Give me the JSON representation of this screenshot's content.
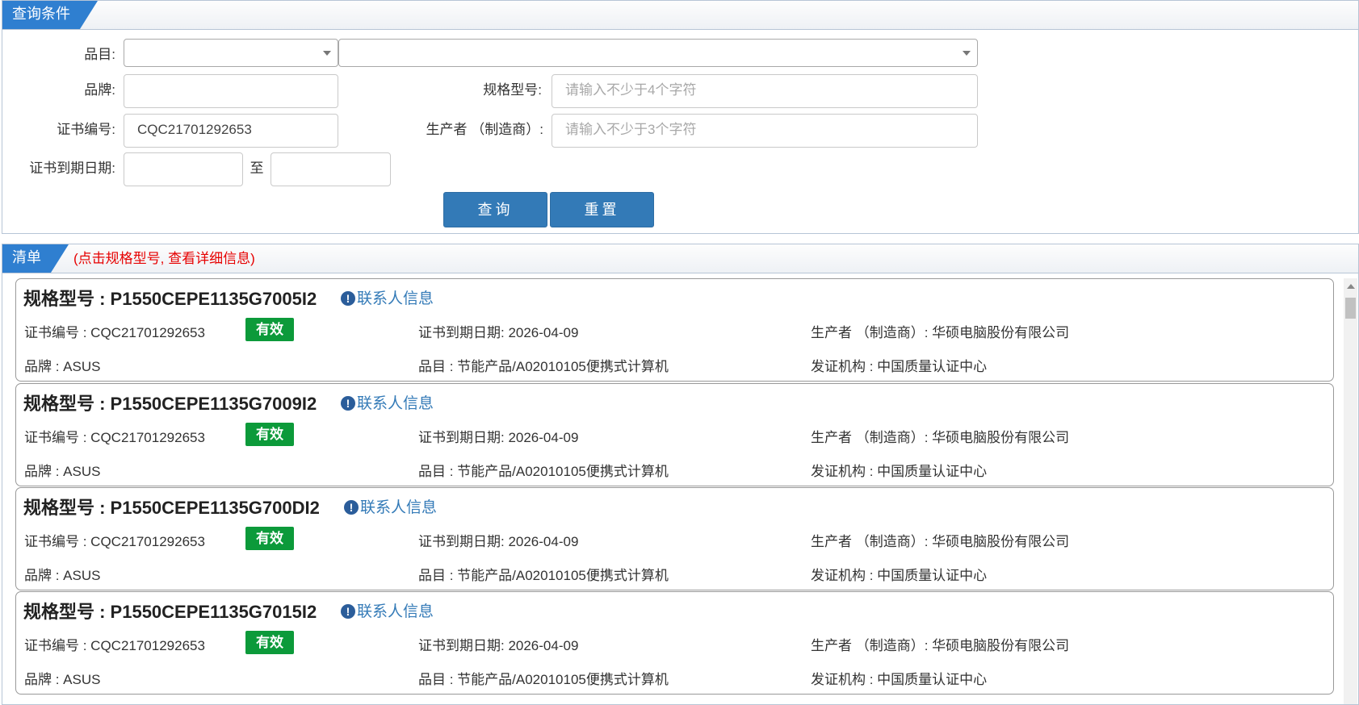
{
  "query": {
    "tab_label": "查询条件",
    "category_label": "品目:",
    "category_value": "",
    "subcategory_value": "",
    "brand_label": "品牌:",
    "brand_value": "",
    "model_label": "规格型号:",
    "model_placeholder": "请输入不少于4个字符",
    "cert_label": "证书编号:",
    "cert_value": "CQC21701292653",
    "manufacturer_label": "生产者 （制造商）:",
    "manufacturer_placeholder": "请输入不少于3个字符",
    "expiry_label": "证书到期日期:",
    "date_sep": "至",
    "search_button": "查询",
    "reset_button": "重置"
  },
  "list": {
    "tab_label": "清单",
    "hint": "(点击规格型号, 查看详细信息)",
    "contact_label": "联系人信息",
    "items": [
      {
        "title": "规格型号 : P1550CEPE1135G7005I2",
        "cert": "证书编号 : CQC21701292653",
        "status": "有效",
        "expiry": "证书到期日期: 2026-04-09",
        "manufacturer": "生产者 （制造商）: 华硕电脑股份有限公司",
        "brand": "品牌 : ASUS",
        "category": "品目 : 节能产品/A02010105便携式计算机",
        "issuer": "发证机构 : 中国质量认证中心"
      },
      {
        "title": "规格型号 : P1550CEPE1135G7009I2",
        "cert": "证书编号 : CQC21701292653",
        "status": "有效",
        "expiry": "证书到期日期: 2026-04-09",
        "manufacturer": "生产者 （制造商）: 华硕电脑股份有限公司",
        "brand": "品牌 : ASUS",
        "category": "品目 : 节能产品/A02010105便携式计算机",
        "issuer": "发证机构 : 中国质量认证中心"
      },
      {
        "title": "规格型号 : P1550CEPE1135G700DI2",
        "cert": "证书编号 : CQC21701292653",
        "status": "有效",
        "expiry": "证书到期日期: 2026-04-09",
        "manufacturer": "生产者 （制造商）: 华硕电脑股份有限公司",
        "brand": "品牌 : ASUS",
        "category": "品目 : 节能产品/A02010105便携式计算机",
        "issuer": "发证机构 : 中国质量认证中心"
      },
      {
        "title": "规格型号 : P1550CEPE1135G7015I2",
        "cert": "证书编号 : CQC21701292653",
        "status": "有效",
        "expiry": "证书到期日期: 2026-04-09",
        "manufacturer": "生产者 （制造商）: 华硕电脑股份有限公司",
        "brand": "品牌 : ASUS",
        "category": "品目 : 节能产品/A02010105便携式计算机",
        "issuer": "发证机构 : 中国质量认证中心"
      }
    ]
  },
  "colors": {
    "primary": "#337ab7",
    "status_valid": "#0c9a3a",
    "hint": "#e60000"
  }
}
